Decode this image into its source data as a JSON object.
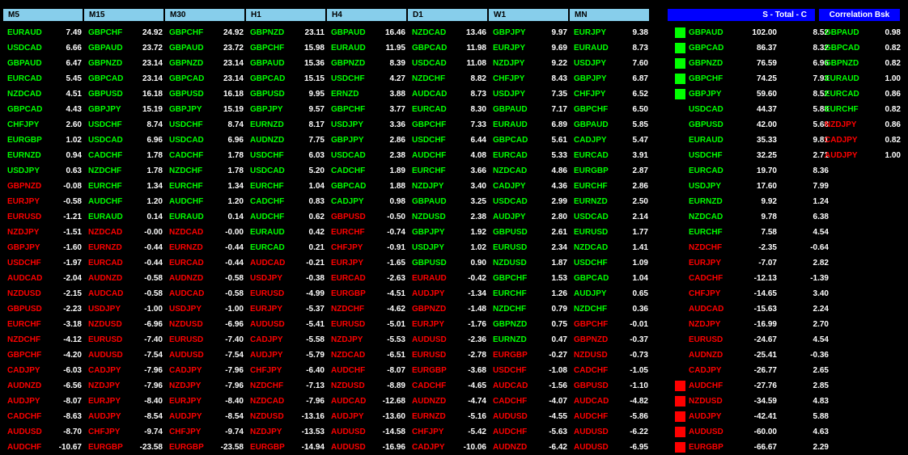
{
  "headers": [
    "M5",
    "M15",
    "M30",
    "H1",
    "H4",
    "D1",
    "W1",
    "MN"
  ],
  "total_header": "S - Total - C",
  "corr_header": "Correlation Bsk",
  "timeframes": [
    [
      [
        "EURAUD",
        "7.49",
        "g"
      ],
      [
        "USDCAD",
        "6.66",
        "g"
      ],
      [
        "GBPAUD",
        "6.47",
        "g"
      ],
      [
        "EURCAD",
        "5.45",
        "g"
      ],
      [
        "NZDCAD",
        "4.51",
        "g"
      ],
      [
        "GBPCAD",
        "4.43",
        "g"
      ],
      [
        "CHFJPY",
        "2.60",
        "g"
      ],
      [
        "EURGBP",
        "1.02",
        "g"
      ],
      [
        "EURNZD",
        "0.94",
        "g"
      ],
      [
        "USDJPY",
        "0.63",
        "g"
      ],
      [
        "GBPNZD",
        "-0.08",
        "r"
      ],
      [
        "EURJPY",
        "-0.58",
        "r"
      ],
      [
        "EURUSD",
        "-1.21",
        "r"
      ],
      [
        "NZDJPY",
        "-1.51",
        "r"
      ],
      [
        "GBPJPY",
        "-1.60",
        "r"
      ],
      [
        "USDCHF",
        "-1.97",
        "r"
      ],
      [
        "AUDCAD",
        "-2.04",
        "r"
      ],
      [
        "NZDUSD",
        "-2.15",
        "r"
      ],
      [
        "GBPUSD",
        "-2.23",
        "r"
      ],
      [
        "EURCHF",
        "-3.18",
        "r"
      ],
      [
        "NZDCHF",
        "-4.12",
        "r"
      ],
      [
        "GBPCHF",
        "-4.20",
        "r"
      ],
      [
        "CADJPY",
        "-6.03",
        "r"
      ],
      [
        "AUDNZD",
        "-6.56",
        "r"
      ],
      [
        "AUDJPY",
        "-8.07",
        "r"
      ],
      [
        "CADCHF",
        "-8.63",
        "r"
      ],
      [
        "AUDUSD",
        "-8.70",
        "r"
      ],
      [
        "AUDCHF",
        "-10.67",
        "r"
      ]
    ],
    [
      [
        "GBPCHF",
        "24.92",
        "g"
      ],
      [
        "GBPAUD",
        "23.72",
        "g"
      ],
      [
        "GBPNZD",
        "23.14",
        "g"
      ],
      [
        "GBPCAD",
        "23.14",
        "g"
      ],
      [
        "GBPUSD",
        "16.18",
        "g"
      ],
      [
        "GBPJPY",
        "15.19",
        "g"
      ],
      [
        "USDCHF",
        "8.74",
        "g"
      ],
      [
        "USDCAD",
        "6.96",
        "g"
      ],
      [
        "CADCHF",
        "1.78",
        "g"
      ],
      [
        "NZDCHF",
        "1.78",
        "g"
      ],
      [
        "EURCHF",
        "1.34",
        "g"
      ],
      [
        "AUDCHF",
        "1.20",
        "g"
      ],
      [
        "EURAUD",
        "0.14",
        "g"
      ],
      [
        "NZDCAD",
        "-0.00",
        "r"
      ],
      [
        "EURNZD",
        "-0.44",
        "r"
      ],
      [
        "EURCAD",
        "-0.44",
        "r"
      ],
      [
        "AUDNZD",
        "-0.58",
        "r"
      ],
      [
        "AUDCAD",
        "-0.58",
        "r"
      ],
      [
        "USDJPY",
        "-1.00",
        "r"
      ],
      [
        "NZDUSD",
        "-6.96",
        "r"
      ],
      [
        "EURUSD",
        "-7.40",
        "r"
      ],
      [
        "AUDUSD",
        "-7.54",
        "r"
      ],
      [
        "CADJPY",
        "-7.96",
        "r"
      ],
      [
        "NZDJPY",
        "-7.96",
        "r"
      ],
      [
        "EURJPY",
        "-8.40",
        "r"
      ],
      [
        "AUDJPY",
        "-8.54",
        "r"
      ],
      [
        "CHFJPY",
        "-9.74",
        "r"
      ],
      [
        "EURGBP",
        "-23.58",
        "r"
      ]
    ],
    [
      [
        "GBPCHF",
        "24.92",
        "g"
      ],
      [
        "GBPAUD",
        "23.72",
        "g"
      ],
      [
        "GBPNZD",
        "23.14",
        "g"
      ],
      [
        "GBPCAD",
        "23.14",
        "g"
      ],
      [
        "GBPUSD",
        "16.18",
        "g"
      ],
      [
        "GBPJPY",
        "15.19",
        "g"
      ],
      [
        "USDCHF",
        "8.74",
        "g"
      ],
      [
        "USDCAD",
        "6.96",
        "g"
      ],
      [
        "CADCHF",
        "1.78",
        "g"
      ],
      [
        "NZDCHF",
        "1.78",
        "g"
      ],
      [
        "EURCHF",
        "1.34",
        "g"
      ],
      [
        "AUDCHF",
        "1.20",
        "g"
      ],
      [
        "EURAUD",
        "0.14",
        "g"
      ],
      [
        "NZDCAD",
        "-0.00",
        "r"
      ],
      [
        "EURNZD",
        "-0.44",
        "r"
      ],
      [
        "EURCAD",
        "-0.44",
        "r"
      ],
      [
        "AUDNZD",
        "-0.58",
        "r"
      ],
      [
        "AUDCAD",
        "-0.58",
        "r"
      ],
      [
        "USDJPY",
        "-1.00",
        "r"
      ],
      [
        "NZDUSD",
        "-6.96",
        "r"
      ],
      [
        "EURUSD",
        "-7.40",
        "r"
      ],
      [
        "AUDUSD",
        "-7.54",
        "r"
      ],
      [
        "CADJPY",
        "-7.96",
        "r"
      ],
      [
        "NZDJPY",
        "-7.96",
        "r"
      ],
      [
        "EURJPY",
        "-8.40",
        "r"
      ],
      [
        "AUDJPY",
        "-8.54",
        "r"
      ],
      [
        "CHFJPY",
        "-9.74",
        "r"
      ],
      [
        "EURGBP",
        "-23.58",
        "r"
      ]
    ],
    [
      [
        "GBPNZD",
        "23.11",
        "g"
      ],
      [
        "GBPCHF",
        "15.98",
        "g"
      ],
      [
        "GBPAUD",
        "15.36",
        "g"
      ],
      [
        "GBPCAD",
        "15.15",
        "g"
      ],
      [
        "GBPUSD",
        "9.95",
        "g"
      ],
      [
        "GBPJPY",
        "9.57",
        "g"
      ],
      [
        "EURNZD",
        "8.17",
        "g"
      ],
      [
        "AUDNZD",
        "7.75",
        "g"
      ],
      [
        "USDCHF",
        "6.03",
        "g"
      ],
      [
        "USDCAD",
        "5.20",
        "g"
      ],
      [
        "EURCHF",
        "1.04",
        "g"
      ],
      [
        "CADCHF",
        "0.83",
        "g"
      ],
      [
        "AUDCHF",
        "0.62",
        "g"
      ],
      [
        "EURAUD",
        "0.42",
        "g"
      ],
      [
        "EURCAD",
        "0.21",
        "g"
      ],
      [
        "AUDCAD",
        "-0.21",
        "r"
      ],
      [
        "USDJPY",
        "-0.38",
        "r"
      ],
      [
        "EURUSD",
        "-4.99",
        "r"
      ],
      [
        "EURJPY",
        "-5.37",
        "r"
      ],
      [
        "AUDUSD",
        "-5.41",
        "r"
      ],
      [
        "CADJPY",
        "-5.58",
        "r"
      ],
      [
        "AUDJPY",
        "-5.79",
        "r"
      ],
      [
        "CHFJPY",
        "-6.40",
        "r"
      ],
      [
        "NZDCHF",
        "-7.13",
        "r"
      ],
      [
        "NZDCAD",
        "-7.96",
        "r"
      ],
      [
        "NZDUSD",
        "-13.16",
        "r"
      ],
      [
        "NZDJPY",
        "-13.53",
        "r"
      ],
      [
        "EURGBP",
        "-14.94",
        "r"
      ]
    ],
    [
      [
        "GBPAUD",
        "16.46",
        "g"
      ],
      [
        "EURAUD",
        "11.95",
        "g"
      ],
      [
        "GBPNZD",
        "8.39",
        "g"
      ],
      [
        "USDCHF",
        "4.27",
        "g"
      ],
      [
        "ERNZD",
        "3.88",
        "g"
      ],
      [
        "GBPCHF",
        "3.77",
        "g"
      ],
      [
        "USDJPY",
        "3.36",
        "g"
      ],
      [
        "GBPJPY",
        "2.86",
        "g"
      ],
      [
        "USDCAD",
        "2.38",
        "g"
      ],
      [
        "CADCHF",
        "1.89",
        "g"
      ],
      [
        "GBPCAD",
        "1.88",
        "g"
      ],
      [
        "CADJPY",
        "0.98",
        "g"
      ],
      [
        "GBPUSD",
        "-0.50",
        "r"
      ],
      [
        "EURCHF",
        "-0.74",
        "r"
      ],
      [
        "CHFJPY",
        "-0.91",
        "r"
      ],
      [
        "EURJPY",
        "-1.65",
        "r"
      ],
      [
        "EURCAD",
        "-2.63",
        "r"
      ],
      [
        "EURGBP",
        "-4.51",
        "r"
      ],
      [
        "NZDCHF",
        "-4.62",
        "r"
      ],
      [
        "EURUSD",
        "-5.01",
        "r"
      ],
      [
        "NZDJPY",
        "-5.53",
        "r"
      ],
      [
        "NZDCAD",
        "-6.51",
        "r"
      ],
      [
        "AUDCHF",
        "-8.07",
        "r"
      ],
      [
        "NZDUSD",
        "-8.89",
        "r"
      ],
      [
        "AUDCAD",
        "-12.68",
        "r"
      ],
      [
        "AUDJPY",
        "-13.60",
        "r"
      ],
      [
        "AUDUSD",
        "-14.58",
        "r"
      ],
      [
        "AUDUSD",
        "-16.96",
        "r"
      ]
    ],
    [
      [
        "NZDCAD",
        "13.46",
        "g"
      ],
      [
        "GBPCAD",
        "11.98",
        "g"
      ],
      [
        "USDCAD",
        "11.08",
        "g"
      ],
      [
        "NZDCHF",
        "8.82",
        "g"
      ],
      [
        "AUDCAD",
        "8.73",
        "g"
      ],
      [
        "EURCAD",
        "8.30",
        "g"
      ],
      [
        "GBPCHF",
        "7.33",
        "g"
      ],
      [
        "USDCHF",
        "6.44",
        "g"
      ],
      [
        "AUDCHF",
        "4.08",
        "g"
      ],
      [
        "EURCHF",
        "3.66",
        "g"
      ],
      [
        "NZDJPY",
        "3.40",
        "g"
      ],
      [
        "GBPAUD",
        "3.25",
        "g"
      ],
      [
        "NZDUSD",
        "2.38",
        "g"
      ],
      [
        "GBPJPY",
        "1.92",
        "g"
      ],
      [
        "USDJPY",
        "1.02",
        "g"
      ],
      [
        "GBPUSD",
        "0.90",
        "g"
      ],
      [
        "EURAUD",
        "-0.42",
        "r"
      ],
      [
        "AUDJPY",
        "-1.34",
        "r"
      ],
      [
        "GBPNZD",
        "-1.48",
        "r"
      ],
      [
        "EURJPY",
        "-1.76",
        "r"
      ],
      [
        "AUDUSD",
        "-2.36",
        "r"
      ],
      [
        "EURUSD",
        "-2.78",
        "r"
      ],
      [
        "EURGBP",
        "-3.68",
        "r"
      ],
      [
        "CADCHF",
        "-4.65",
        "r"
      ],
      [
        "AUDNZD",
        "-4.74",
        "r"
      ],
      [
        "EURNZD",
        "-5.16",
        "r"
      ],
      [
        "CHFJPY",
        "-5.42",
        "r"
      ],
      [
        "CADJPY",
        "-10.06",
        "r"
      ]
    ],
    [
      [
        "GBPJPY",
        "9.97",
        "g"
      ],
      [
        "EURJPY",
        "9.69",
        "g"
      ],
      [
        "NZDJPY",
        "9.22",
        "g"
      ],
      [
        "CHFJPY",
        "8.43",
        "g"
      ],
      [
        "USDJPY",
        "7.35",
        "g"
      ],
      [
        "GBPAUD",
        "7.17",
        "g"
      ],
      [
        "EURAUD",
        "6.89",
        "g"
      ],
      [
        "GBPCAD",
        "5.61",
        "g"
      ],
      [
        "EURCAD",
        "5.33",
        "g"
      ],
      [
        "NZDCAD",
        "4.86",
        "g"
      ],
      [
        "CADJPY",
        "4.36",
        "g"
      ],
      [
        "USDCAD",
        "2.99",
        "g"
      ],
      [
        "AUDJPY",
        "2.80",
        "g"
      ],
      [
        "GBPUSD",
        "2.61",
        "g"
      ],
      [
        "EURUSD",
        "2.34",
        "g"
      ],
      [
        "NZDUSD",
        "1.87",
        "g"
      ],
      [
        "GBPCHF",
        "1.53",
        "g"
      ],
      [
        "EURCHF",
        "1.26",
        "g"
      ],
      [
        "NZDCHF",
        "0.79",
        "g"
      ],
      [
        "GBPNZD",
        "0.75",
        "g"
      ],
      [
        "EURNZD",
        "0.47",
        "g"
      ],
      [
        "EURGBP",
        "-0.27",
        "r"
      ],
      [
        "USDCHF",
        "-1.08",
        "r"
      ],
      [
        "AUDCAD",
        "-1.56",
        "r"
      ],
      [
        "CADCHF",
        "-4.07",
        "r"
      ],
      [
        "AUDUSD",
        "-4.55",
        "r"
      ],
      [
        "AUDCHF",
        "-5.63",
        "r"
      ],
      [
        "AUDNZD",
        "-6.42",
        "r"
      ]
    ],
    [
      [
        "EURJPY",
        "9.38",
        "g"
      ],
      [
        "EURAUD",
        "8.73",
        "g"
      ],
      [
        "USDJPY",
        "7.60",
        "g"
      ],
      [
        "GBPJPY",
        "6.87",
        "g"
      ],
      [
        "CHFJPY",
        "6.52",
        "g"
      ],
      [
        "GBPCHF",
        "6.50",
        "g"
      ],
      [
        "GBPAUD",
        "5.85",
        "g"
      ],
      [
        "CADJPY",
        "5.47",
        "g"
      ],
      [
        "EURCAD",
        "3.91",
        "g"
      ],
      [
        "EURGBP",
        "2.87",
        "g"
      ],
      [
        "EURCHF",
        "2.86",
        "g"
      ],
      [
        "EURNZD",
        "2.50",
        "g"
      ],
      [
        "USDCAD",
        "2.14",
        "g"
      ],
      [
        "EURUSD",
        "1.77",
        "g"
      ],
      [
        "NZDCAD",
        "1.41",
        "g"
      ],
      [
        "USDCHF",
        "1.09",
        "g"
      ],
      [
        "GBPCAD",
        "1.04",
        "g"
      ],
      [
        "AUDJPY",
        "0.65",
        "g"
      ],
      [
        "NZDCHF",
        "0.36",
        "g"
      ],
      [
        "GBPCHF",
        "-0.01",
        "r"
      ],
      [
        "GBPNZD",
        "-0.37",
        "r"
      ],
      [
        "NZDUSD",
        "-0.73",
        "r"
      ],
      [
        "CADCHF",
        "-1.05",
        "r"
      ],
      [
        "GBPUSD",
        "-1.10",
        "r"
      ],
      [
        "AUDCAD",
        "-4.82",
        "r"
      ],
      [
        "AUDCHF",
        "-5.86",
        "r"
      ],
      [
        "AUDUSD",
        "-6.22",
        "r"
      ],
      [
        "AUDUSD",
        "-6.95",
        "r"
      ]
    ]
  ],
  "totals": [
    [
      "GBPAUD",
      "102.00",
      "8.52",
      "g",
      "sq-g"
    ],
    [
      "GBPCAD",
      "86.37",
      "8.32",
      "g",
      "sq-g"
    ],
    [
      "GBPNZD",
      "76.59",
      "6.96",
      "g",
      "sq-g"
    ],
    [
      "GBPCHF",
      "74.25",
      "7.93",
      "g",
      "sq-g"
    ],
    [
      "GBPJPY",
      "59.60",
      "8.52",
      "g",
      "sq-g"
    ],
    [
      "USDCAD",
      "44.37",
      "5.88",
      "g",
      ""
    ],
    [
      "GBPUSD",
      "42.00",
      "5.68",
      "g",
      ""
    ],
    [
      "EURAUD",
      "35.33",
      "9.81",
      "g",
      ""
    ],
    [
      "USDCHF",
      "32.25",
      "2.71",
      "g",
      ""
    ],
    [
      "EURCAD",
      "19.70",
      "8.36",
      "g",
      ""
    ],
    [
      "USDJPY",
      "17.60",
      "7.99",
      "g",
      ""
    ],
    [
      "EURNZD",
      "9.92",
      "1.24",
      "g",
      ""
    ],
    [
      "NZDCAD",
      "9.78",
      "6.38",
      "g",
      ""
    ],
    [
      "EURCHF",
      "7.58",
      "4.54",
      "g",
      ""
    ],
    [
      "NZDCHF",
      "-2.35",
      "-0.64",
      "r",
      ""
    ],
    [
      "EURJPY",
      "-7.07",
      "2.82",
      "r",
      ""
    ],
    [
      "CADCHF",
      "-12.13",
      "-1.39",
      "r",
      ""
    ],
    [
      "CHFJPY",
      "-14.65",
      "3.40",
      "r",
      ""
    ],
    [
      "AUDCAD",
      "-15.63",
      "2.24",
      "r",
      ""
    ],
    [
      "NZDJPY",
      "-16.99",
      "2.70",
      "r",
      ""
    ],
    [
      "EURUSD",
      "-24.67",
      "4.54",
      "r",
      ""
    ],
    [
      "AUDNZD",
      "-25.41",
      "-0.36",
      "r",
      ""
    ],
    [
      "CADJPY",
      "-26.77",
      "2.65",
      "r",
      ""
    ],
    [
      "AUDCHF",
      "-27.76",
      "2.85",
      "r",
      "sq-r"
    ],
    [
      "NZDUSD",
      "-34.59",
      "4.83",
      "r",
      "sq-r"
    ],
    [
      "AUDJPY",
      "-42.41",
      "5.88",
      "r",
      "sq-r"
    ],
    [
      "AUDUSD",
      "-60.00",
      "4.63",
      "r",
      "sq-r"
    ],
    [
      "EURGBP",
      "-66.67",
      "2.29",
      "r",
      "sq-r"
    ]
  ],
  "correlation": [
    [
      "GBPAUD",
      "0.98",
      "g"
    ],
    [
      "GBPCAD",
      "0.82",
      "g"
    ],
    [
      "GBPNZD",
      "0.82",
      "g"
    ],
    [
      "EURAUD",
      "1.00",
      "g"
    ],
    [
      "EURCAD",
      "0.86",
      "g"
    ],
    [
      "EURCHF",
      "0.82",
      "g"
    ],
    [
      "NZDJPY",
      "0.86",
      "r"
    ],
    [
      "CADJPY",
      "0.82",
      "r"
    ],
    [
      "AUDJPY",
      "1.00",
      "r"
    ]
  ]
}
